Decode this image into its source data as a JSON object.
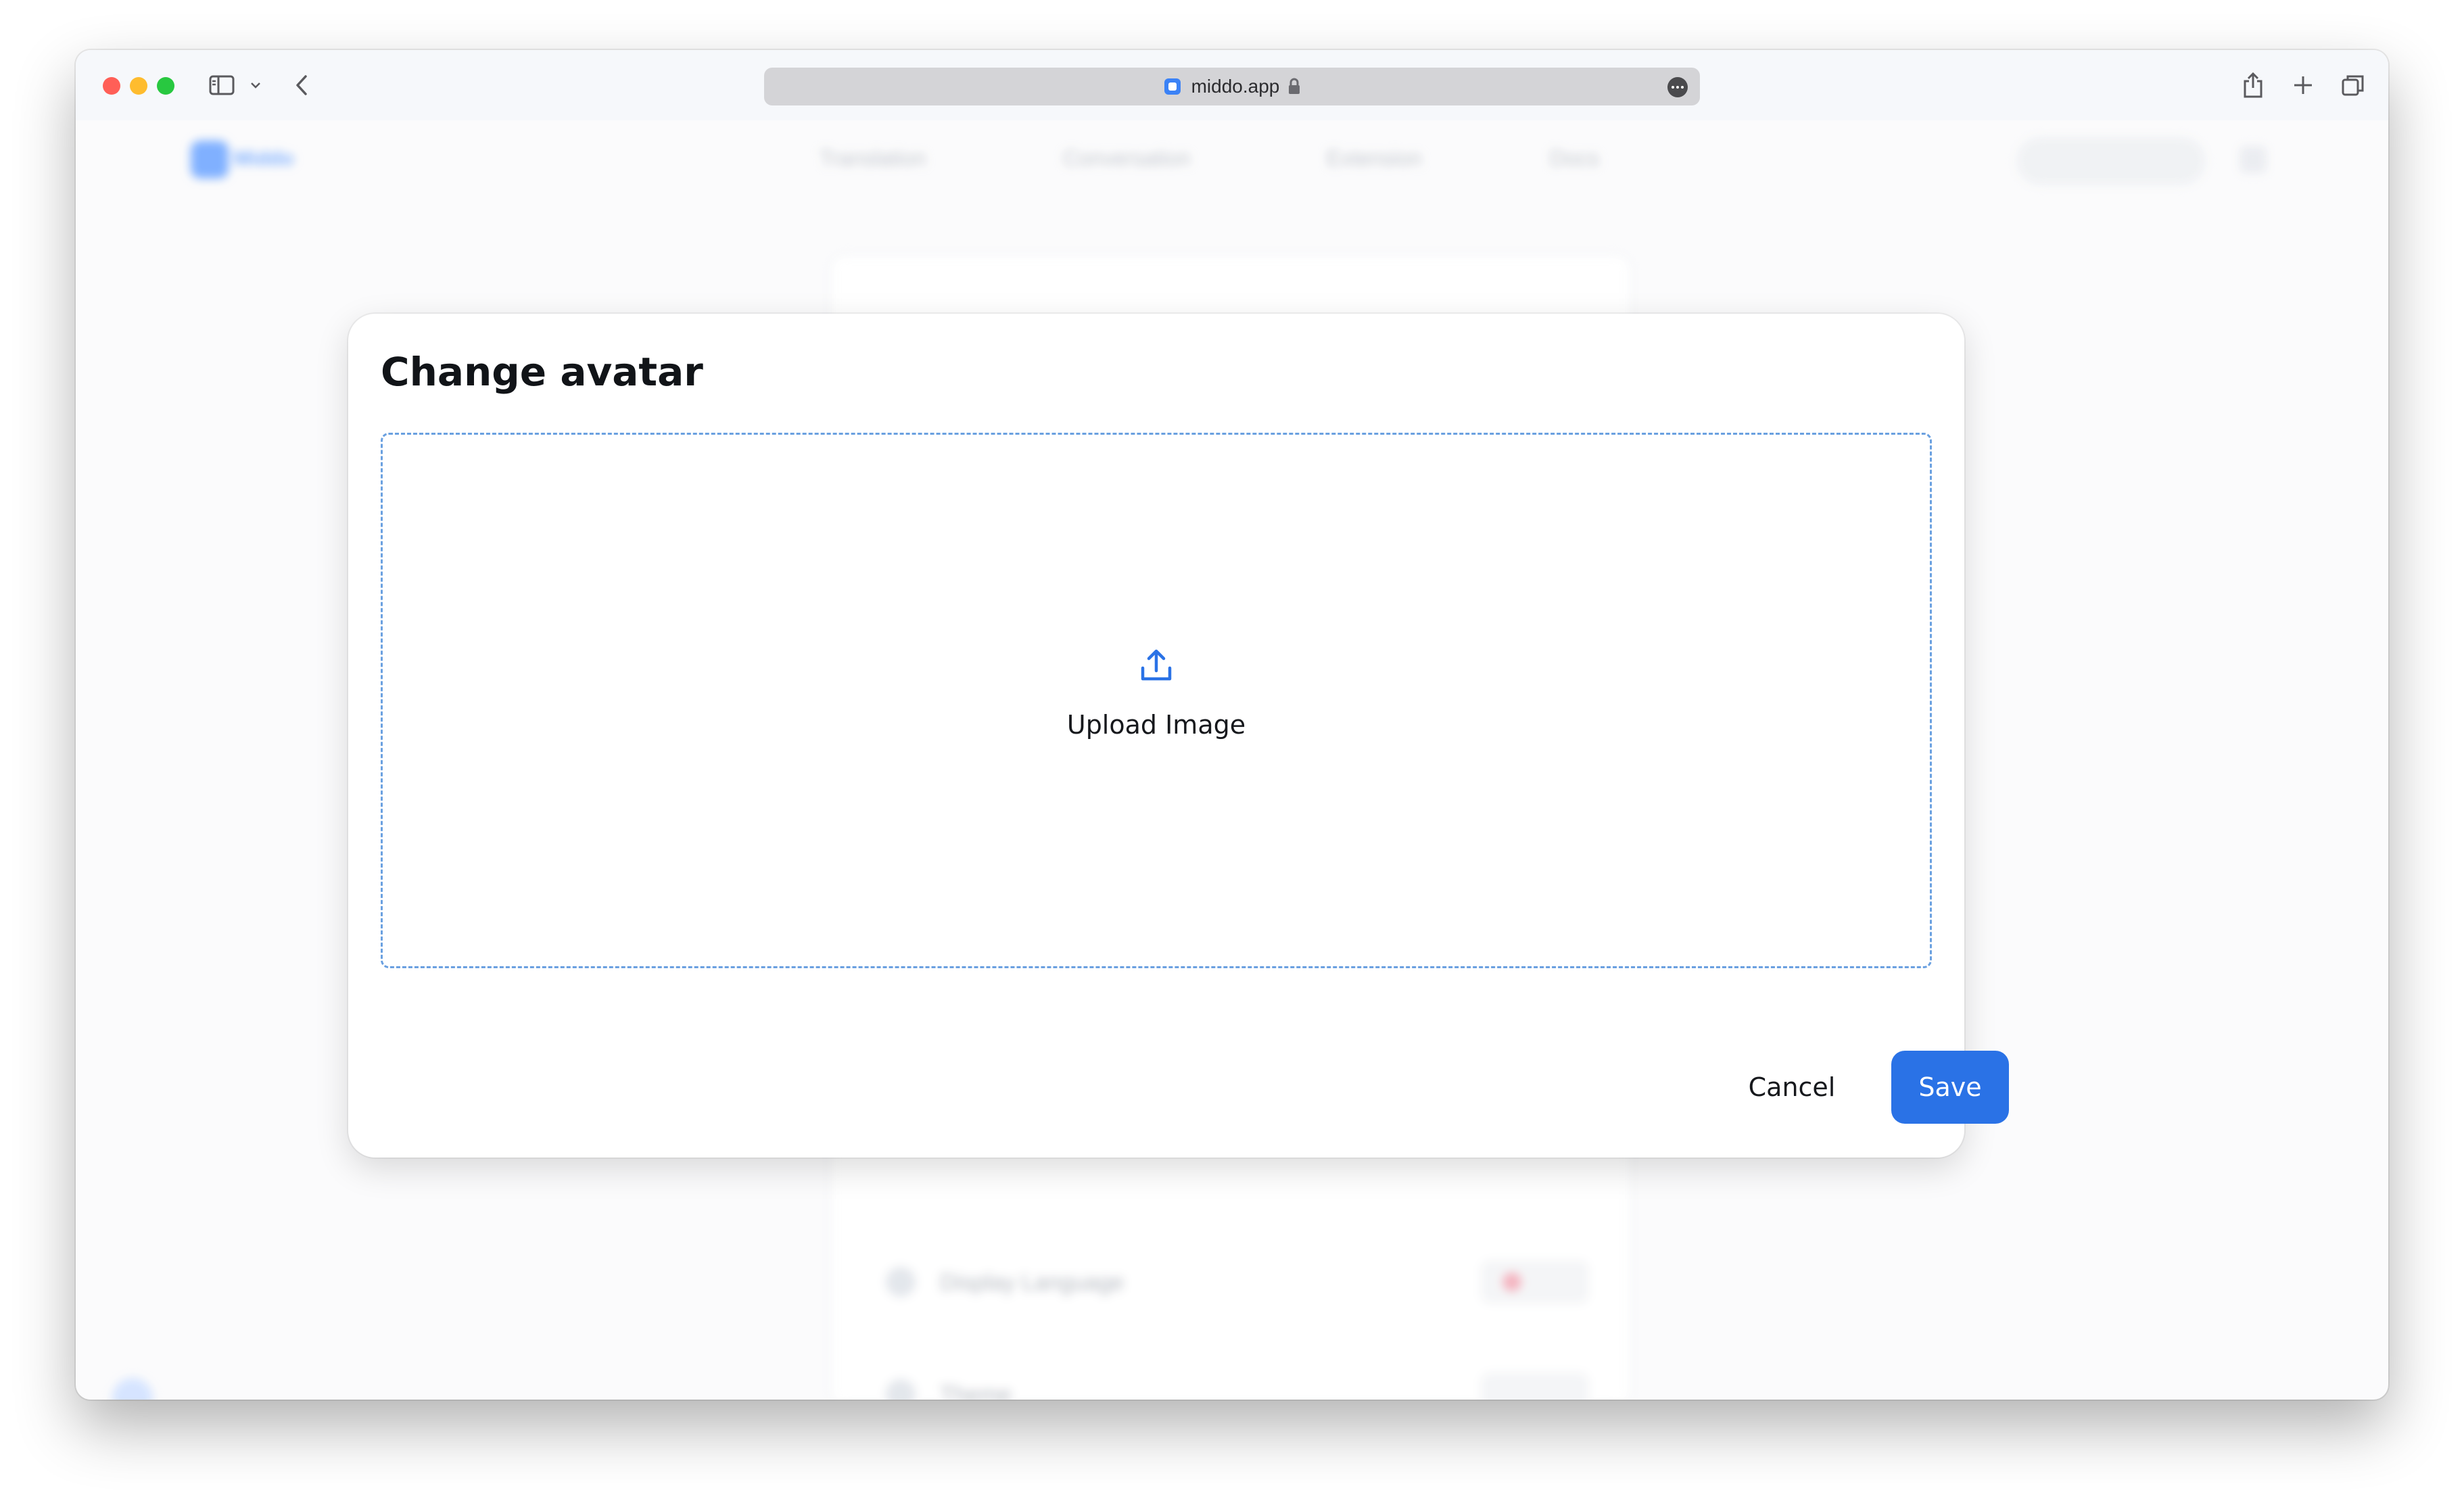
{
  "browser": {
    "url": "middo.app",
    "icons": [
      "sidebar-toggle-icon",
      "chevron-down-icon",
      "back-arrow-icon",
      "share-icon",
      "new-tab-plus-icon",
      "tab-overview-icon",
      "lock-icon",
      "more-options-icon"
    ]
  },
  "background": {
    "nav": [
      "Translation",
      "Conversation",
      "Extension",
      "Docs"
    ]
  },
  "modal": {
    "title": "Change avatar",
    "dropzone": {
      "label": "Upload Image",
      "icon": "upload-icon"
    },
    "cancel_label": "Cancel",
    "save_label": "Save"
  },
  "colors": {
    "primary": "#2a72e6",
    "dropzone_border": "#6aa0e0"
  }
}
